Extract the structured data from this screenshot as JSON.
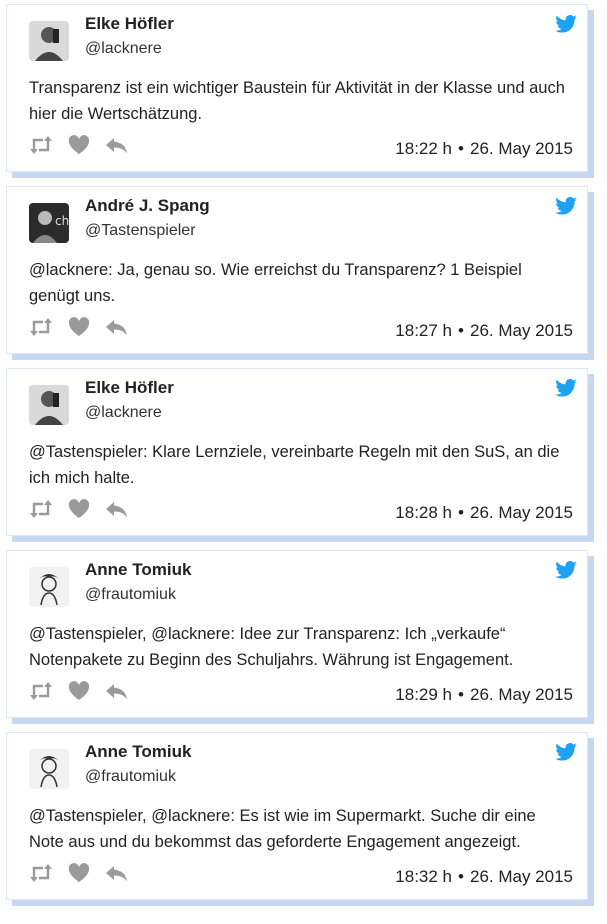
{
  "tweets": [
    {
      "name": "Elke Höfler",
      "handle": "@lacknere",
      "text": "Transparenz ist ein wichtiger Baustein für Aktivität in der Klasse und auch hier die Wertschätzung.",
      "time": "18:22 h",
      "date": "26. May 2015",
      "avatar": "elke-avatar"
    },
    {
      "name": "André J. Spang",
      "handle": "@Tastenspieler",
      "text": "@lacknere: Ja, genau so. Wie erreichst du Transparenz? 1 Beispiel genügt uns.",
      "time": "18:27 h",
      "date": "26. May 2015",
      "avatar": "andre-avatar"
    },
    {
      "name": "Elke Höfler",
      "handle": "@lacknere",
      "text": "@Tastenspieler: Klare Lernziele, vereinbarte Regeln mit den SuS, an die ich mich halte.",
      "time": "18:28 h",
      "date": "26. May 2015",
      "avatar": "elke-avatar"
    },
    {
      "name": "Anne Tomiuk",
      "handle": "@frautomiuk",
      "text": "@Tastenspieler, @lacknere: Idee zur Transparenz: Ich „verkaufe“ Notenpakete zu Beginn des Schuljahrs. Währung ist Engagement.",
      "time": "18:29 h",
      "date": "26. May 2015",
      "avatar": "anne-avatar"
    },
    {
      "name": "Anne Tomiuk",
      "handle": "@frautomiuk",
      "text": "@Tastenspieler, @lacknere: Es ist wie im Supermarkt. Suche dir eine Note aus und du bekommst das geforderte Engagement angezeigt.",
      "time": "18:32 h",
      "date": "26. May 2015",
      "avatar": "anne-avatar"
    }
  ],
  "separator": "•",
  "colors": {
    "twitter_blue": "#1da1f2",
    "action_gray": "#9a9a9a",
    "shadow_blue": "#c7d7f2"
  }
}
